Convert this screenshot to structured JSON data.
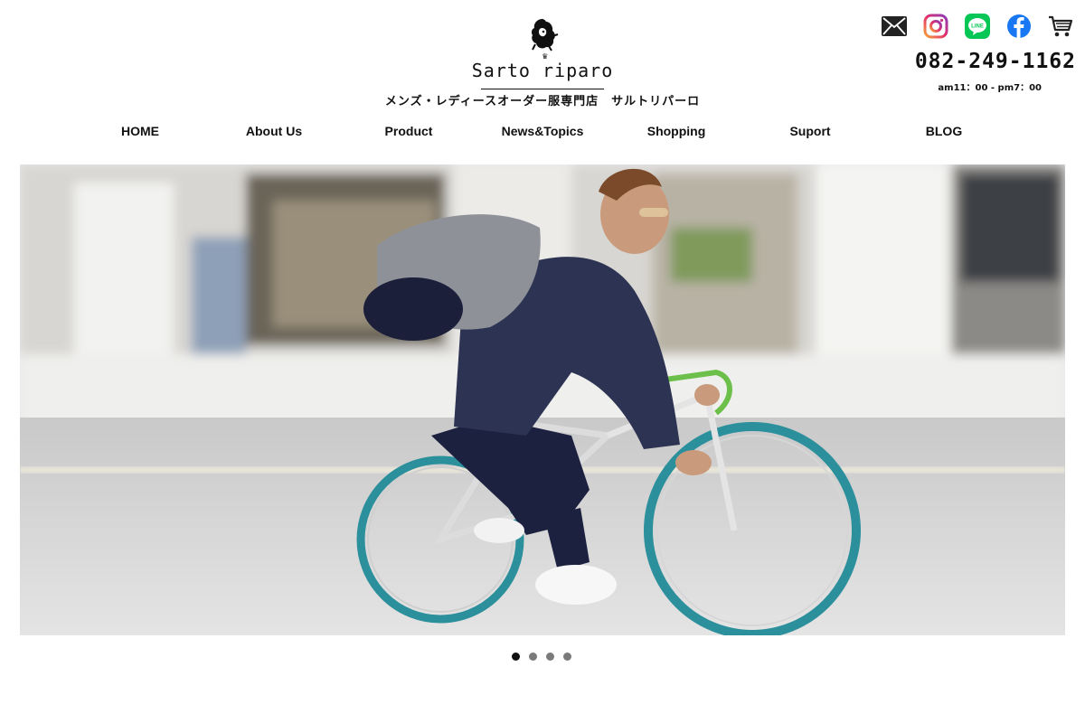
{
  "brand": {
    "logo_text": "Sarto riparo",
    "tagline": "メンズ・レディースオーダー服専門店　サルトリパーロ"
  },
  "contact": {
    "phone": "082-249-1162",
    "hours": "am11：00 - pm7：00"
  },
  "social_icons": [
    "mail-icon",
    "instagram-icon",
    "line-icon",
    "facebook-icon",
    "cart-icon"
  ],
  "nav": {
    "items": [
      {
        "label": "HOME"
      },
      {
        "label": "About Us"
      },
      {
        "label": "Product"
      },
      {
        "label": "News&Topics"
      },
      {
        "label": "Shopping"
      },
      {
        "label": "Suport"
      },
      {
        "label": "BLOG"
      }
    ]
  },
  "slider": {
    "slide_count": 4,
    "active_index": 0
  },
  "colors": {
    "text": "#111111",
    "line_green": "#06C755",
    "facebook_blue": "#1877F2",
    "instagram_pink": "#D6249F",
    "dot_inactive": "#7a7a7a",
    "wheel_teal": "#2b8f9c"
  }
}
